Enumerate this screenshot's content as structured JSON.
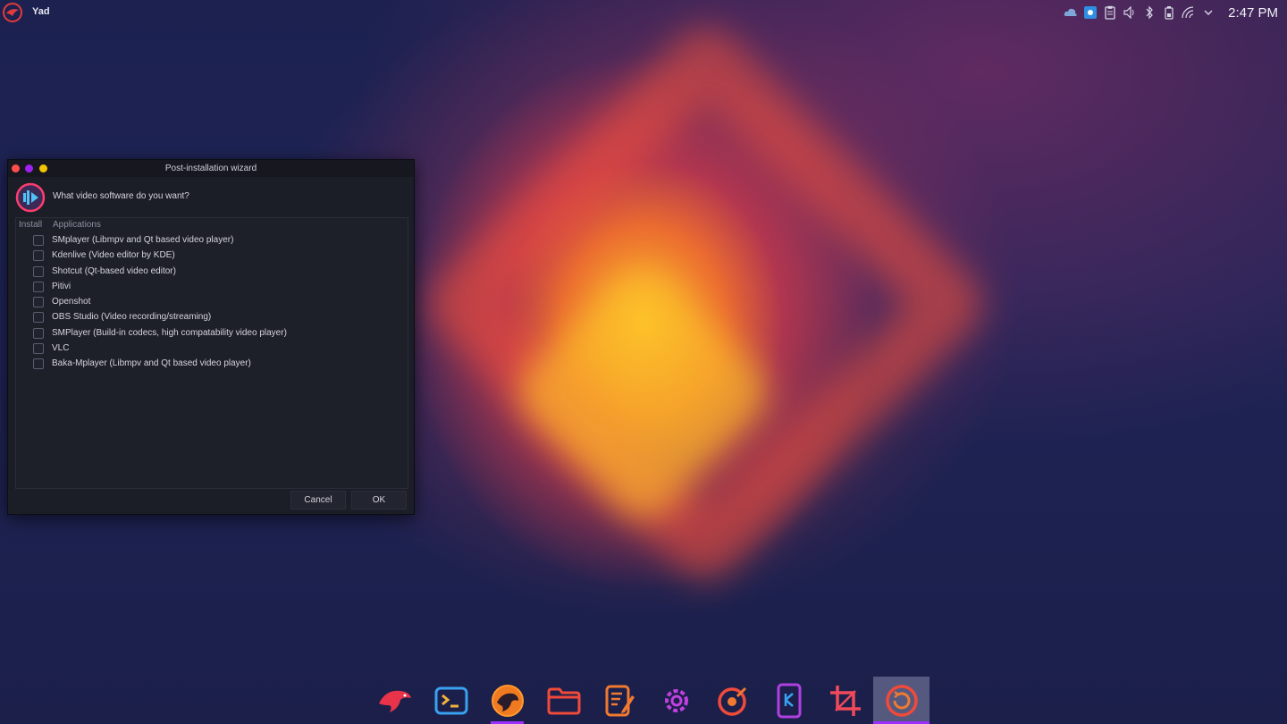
{
  "topbar": {
    "app_name": "Yad",
    "clock": "2:47 PM",
    "tray_icons": [
      "cloud-icon",
      "screenshot-icon",
      "clipboard-icon",
      "volume-icon",
      "bluetooth-icon",
      "battery-icon",
      "wifi-icon",
      "chevron-down-icon"
    ]
  },
  "dialog": {
    "title": "Post-installation wizard",
    "question": "What video software do you want?",
    "columns": {
      "install": "Install",
      "applications": "Applications"
    },
    "items": [
      {
        "label": "SMplayer (Libmpv and Qt based video player)",
        "checked": false
      },
      {
        "label": "Kdenlive (Video editor by KDE)",
        "checked": false
      },
      {
        "label": "Shotcut (Qt-based video editor)",
        "checked": false
      },
      {
        "label": "Pitivi",
        "checked": false
      },
      {
        "label": "Openshot",
        "checked": false
      },
      {
        "label": "OBS Studio (Video recording/streaming)",
        "checked": false
      },
      {
        "label": "SMPlayer (Build-in codecs, high compatability video player)",
        "checked": false
      },
      {
        "label": "VLC",
        "checked": false
      },
      {
        "label": "Baka-Mplayer (Libmpv and Qt based video player)",
        "checked": false
      }
    ],
    "cancel_label": "Cancel",
    "ok_label": "OK"
  },
  "dock": {
    "items": [
      "eagle-icon",
      "terminal-icon",
      "browser-icon",
      "folder-icon",
      "text-editor-icon",
      "settings-icon",
      "music-icon",
      "kde-connect-icon",
      "crop-icon",
      "update-icon"
    ]
  },
  "colors": {
    "accent": "#9b30ff",
    "dialog_bg": "#1b1d27",
    "close_dot": "#ff4d4d",
    "min_dot": "#a020f0",
    "max_dot": "#f2c400"
  }
}
